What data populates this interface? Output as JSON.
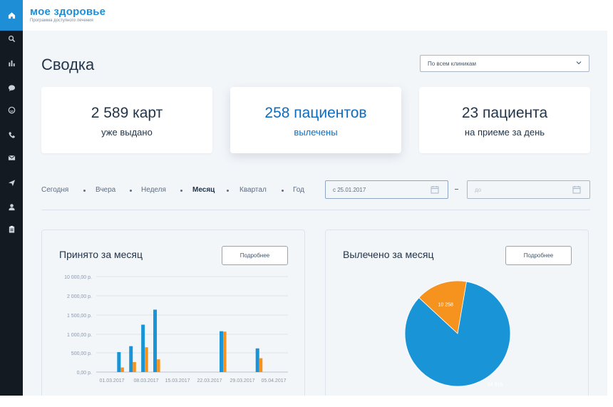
{
  "app": {
    "logo_title": "мое здоровье",
    "logo_subtitle": "Программа доступного лечения"
  },
  "sidebar": {
    "items": [
      {
        "icon": "home-icon",
        "active": true
      },
      {
        "icon": "search-icon",
        "active": false
      },
      {
        "icon": "bar-chart-icon",
        "active": false
      },
      {
        "icon": "chat-icon",
        "active": false
      },
      {
        "icon": "smile-icon",
        "active": false
      },
      {
        "icon": "phone-icon",
        "active": false
      },
      {
        "icon": "mail-icon",
        "active": false
      },
      {
        "icon": "send-icon",
        "active": false
      },
      {
        "icon": "user-icon",
        "active": false
      },
      {
        "icon": "clipboard-icon",
        "active": false
      }
    ]
  },
  "page": {
    "title": "Сводка"
  },
  "clinic_select": {
    "value": "По всем клиникам"
  },
  "stats": [
    {
      "value": "2 589 карт",
      "label": "уже выдано",
      "featured": false
    },
    {
      "value": "258 пациентов",
      "label": "вылечены",
      "featured": true
    },
    {
      "value": "23 пациента",
      "label": "на приеме за день",
      "featured": false
    }
  ],
  "periods": [
    {
      "label": "Сегодня",
      "active": false
    },
    {
      "label": "Вчера",
      "active": false
    },
    {
      "label": "Неделя",
      "active": false
    },
    {
      "label": "Месяц",
      "active": true
    },
    {
      "label": "Квартал",
      "active": false
    },
    {
      "label": "Год",
      "active": false
    }
  ],
  "date_from": {
    "value": "с 25.01.2017"
  },
  "date_to": {
    "placeholder": "до"
  },
  "panels": {
    "left": {
      "title": "Принято за месяц",
      "button": "Подробнее"
    },
    "right": {
      "title": "Вылечено за месяц",
      "button": "Подробнее"
    }
  },
  "colors": {
    "accent": "#1e8ed6",
    "blue_series": "#1994d6",
    "orange_series": "#f5931e",
    "sidebar": "#141a22",
    "featured_text": "#0d6cc0"
  },
  "chart_data": [
    {
      "type": "bar",
      "y_tick_labels": [
        "0,00 р.",
        "500,00 р.",
        "1 000,00 р.",
        "1 500,00 р.",
        "2 000,00 р.",
        "10 000,00 р."
      ],
      "x_tick_labels": [
        "01.03.2017",
        "08.03.2017",
        "15.03.2017",
        "22.03.2017",
        "29.03.2017",
        "05.04.2017"
      ],
      "grid": true,
      "series": [
        {
          "color": "#1994d6",
          "points": [
            [
              3,
              520
            ],
            [
              5,
              680
            ],
            [
              7,
              1250
            ],
            [
              9,
              1640
            ],
            [
              20,
              1080
            ],
            [
              26,
              620
            ]
          ]
        },
        {
          "color": "#f5931e",
          "points": [
            [
              3.6,
              120
            ],
            [
              5.6,
              260
            ],
            [
              7.6,
              650
            ],
            [
              9.6,
              330
            ],
            [
              20.6,
              1070
            ],
            [
              26.6,
              360
            ]
          ]
        }
      ]
    },
    {
      "type": "pie",
      "slices": [
        {
          "label": "54 616",
          "value": 54616,
          "color": "#1994d6"
        },
        {
          "label": "10 258",
          "value": 10258,
          "color": "#f5931e"
        }
      ]
    }
  ]
}
